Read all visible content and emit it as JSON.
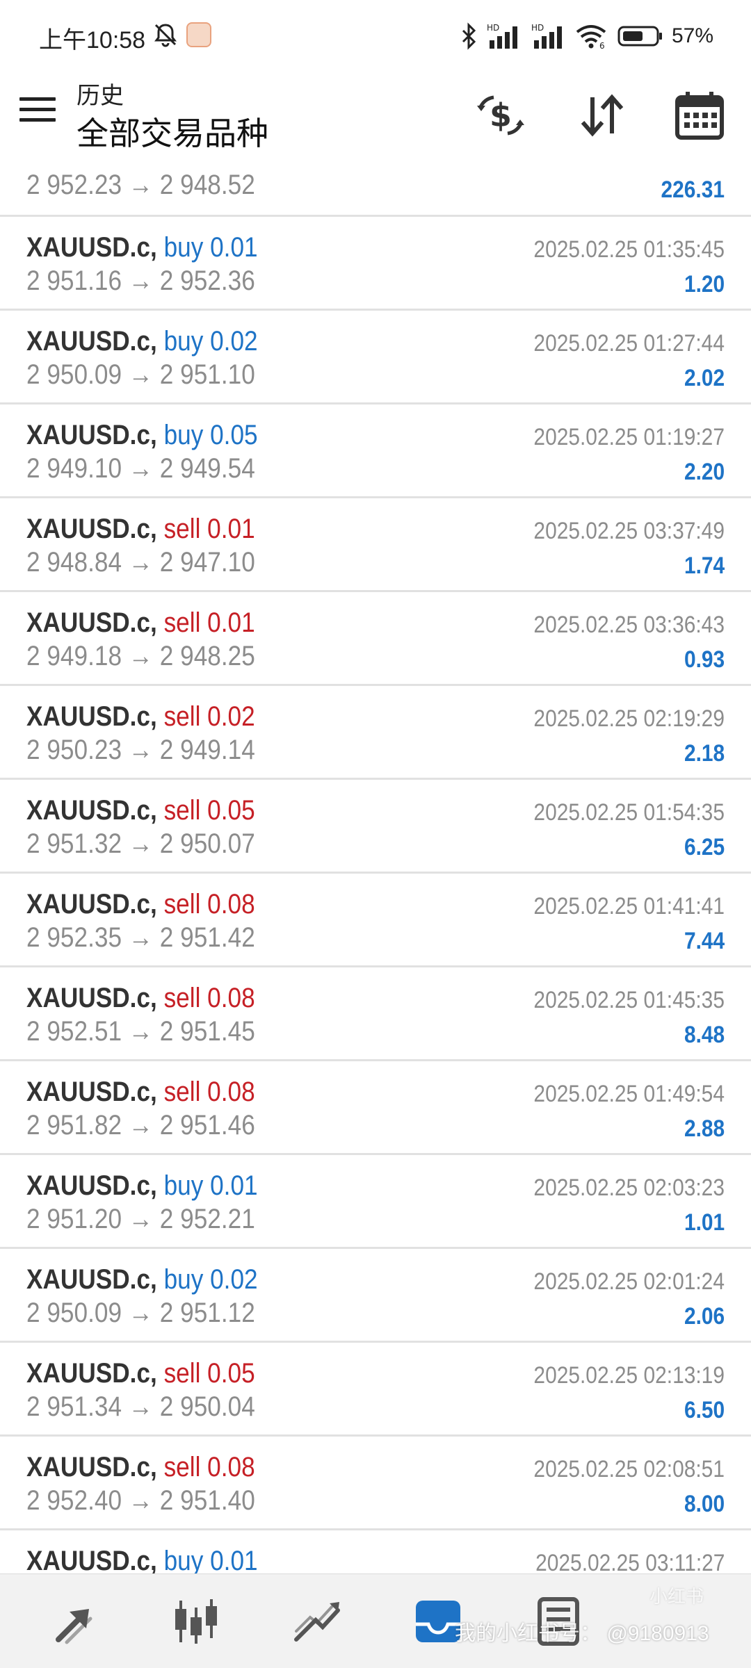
{
  "status_bar": {
    "time": "上午10:58",
    "battery": "57%",
    "icons": [
      "mute-bell-icon",
      "avatar-icon",
      "bluetooth-icon",
      "signal-hd-1-icon",
      "signal-hd-2-icon",
      "wifi-icon",
      "battery-icon"
    ]
  },
  "header": {
    "title_small": "历史",
    "title_big": "全部交易品种",
    "icons": [
      "menu-icon",
      "currency-exchange-icon",
      "sort-icon",
      "calendar-icon"
    ]
  },
  "colors": {
    "buy": "#1e73c6",
    "sell": "#c62026",
    "profit": "#1e73c6",
    "muted": "#8c8c8c"
  },
  "partial_row": {
    "prices": "2 952.23 → 2 948.52",
    "profit": "226.31"
  },
  "trades": [
    {
      "symbol": "XAUUSD.c,",
      "type": "buy 0.01",
      "side": "buy",
      "prices": "2 951.16 → 2 952.36",
      "time": "2025.02.25 01:35:45",
      "profit": "1.20"
    },
    {
      "symbol": "XAUUSD.c,",
      "type": "buy 0.02",
      "side": "buy",
      "prices": "2 950.09 → 2 951.10",
      "time": "2025.02.25 01:27:44",
      "profit": "2.02"
    },
    {
      "symbol": "XAUUSD.c,",
      "type": "buy 0.05",
      "side": "buy",
      "prices": "2 949.10 → 2 949.54",
      "time": "2025.02.25 01:19:27",
      "profit": "2.20"
    },
    {
      "symbol": "XAUUSD.c,",
      "type": "sell 0.01",
      "side": "sell",
      "prices": "2 948.84 → 2 947.10",
      "time": "2025.02.25 03:37:49",
      "profit": "1.74"
    },
    {
      "symbol": "XAUUSD.c,",
      "type": "sell 0.01",
      "side": "sell",
      "prices": "2 949.18 → 2 948.25",
      "time": "2025.02.25 03:36:43",
      "profit": "0.93"
    },
    {
      "symbol": "XAUUSD.c,",
      "type": "sell 0.02",
      "side": "sell",
      "prices": "2 950.23 → 2 949.14",
      "time": "2025.02.25 02:19:29",
      "profit": "2.18"
    },
    {
      "symbol": "XAUUSD.c,",
      "type": "sell 0.05",
      "side": "sell",
      "prices": "2 951.32 → 2 950.07",
      "time": "2025.02.25 01:54:35",
      "profit": "6.25"
    },
    {
      "symbol": "XAUUSD.c,",
      "type": "sell 0.08",
      "side": "sell",
      "prices": "2 952.35 → 2 951.42",
      "time": "2025.02.25 01:41:41",
      "profit": "7.44"
    },
    {
      "symbol": "XAUUSD.c,",
      "type": "sell 0.08",
      "side": "sell",
      "prices": "2 952.51 → 2 951.45",
      "time": "2025.02.25 01:45:35",
      "profit": "8.48"
    },
    {
      "symbol": "XAUUSD.c,",
      "type": "sell 0.08",
      "side": "sell",
      "prices": "2 951.82 → 2 951.46",
      "time": "2025.02.25 01:49:54",
      "profit": "2.88"
    },
    {
      "symbol": "XAUUSD.c,",
      "type": "buy 0.01",
      "side": "buy",
      "prices": "2 951.20 → 2 952.21",
      "time": "2025.02.25 02:03:23",
      "profit": "1.01"
    },
    {
      "symbol": "XAUUSD.c,",
      "type": "buy 0.02",
      "side": "buy",
      "prices": "2 950.09 → 2 951.12",
      "time": "2025.02.25 02:01:24",
      "profit": "2.06"
    },
    {
      "symbol": "XAUUSD.c,",
      "type": "sell 0.05",
      "side": "sell",
      "prices": "2 951.34 → 2 950.04",
      "time": "2025.02.25 02:13:19",
      "profit": "6.50"
    },
    {
      "symbol": "XAUUSD.c,",
      "type": "sell 0.08",
      "side": "sell",
      "prices": "2 952.40 → 2 951.40",
      "time": "2025.02.25 02:08:51",
      "profit": "8.00"
    },
    {
      "symbol": "XAUUSD.c,",
      "type": "buy 0.01",
      "side": "buy",
      "prices": "",
      "time": "2025.02.25 03:11:27",
      "profit": ""
    }
  ],
  "bottom_nav": {
    "items": [
      {
        "name": "quotes",
        "icon": "quotes-icon",
        "active": false
      },
      {
        "name": "chart",
        "icon": "candlestick-chart-icon",
        "active": false
      },
      {
        "name": "trade",
        "icon": "trade-trend-icon",
        "active": false
      },
      {
        "name": "history",
        "icon": "inbox-history-icon",
        "active": true
      },
      {
        "name": "messages",
        "icon": "news-icon",
        "active": false
      }
    ],
    "watermark": "我的小红书号：  @9180913",
    "badge": "小红书"
  }
}
